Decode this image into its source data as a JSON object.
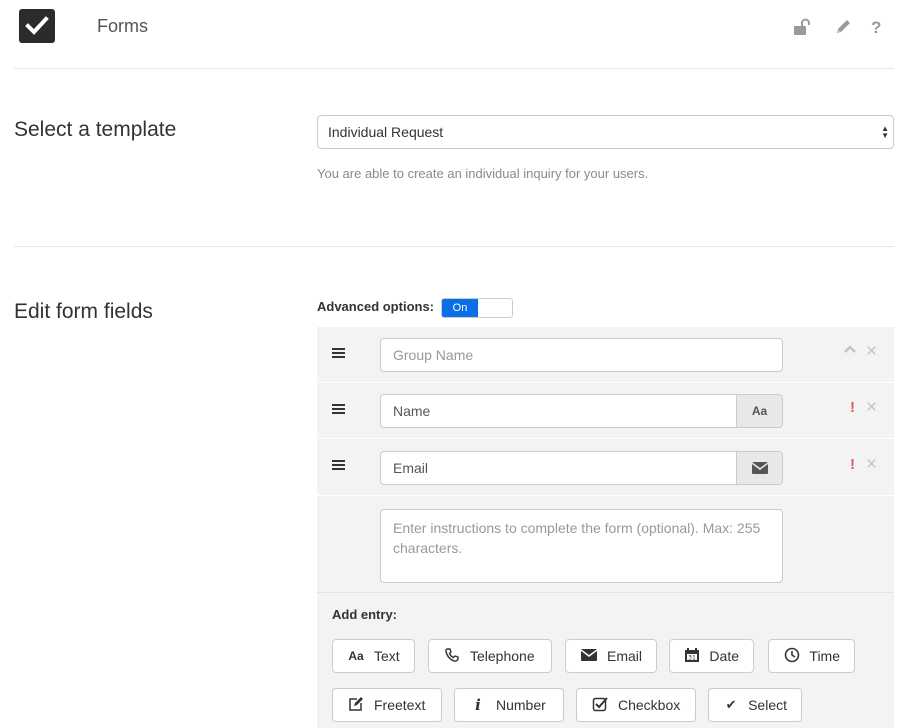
{
  "header": {
    "title": "Forms",
    "logo_icon": "checkbox-icon",
    "actions": [
      {
        "name": "unlock-icon"
      },
      {
        "name": "edit-icon"
      },
      {
        "name": "help-icon",
        "glyph": "?"
      }
    ]
  },
  "template": {
    "section_title": "Select a template",
    "selected": "Individual Request",
    "description": "You are able to create an individual inquiry for your users."
  },
  "fields": {
    "section_title": "Edit form fields",
    "advanced_label": "Advanced options:",
    "advanced_toggle": "On",
    "rows": [
      {
        "placeholder": "Group Name",
        "value": ""
      },
      {
        "value": "Name",
        "addon": "Aa",
        "required_mark": "!"
      },
      {
        "value": "Email",
        "addon_icon": "envelope-icon",
        "required_mark": "!"
      }
    ],
    "instructions_placeholder": "Enter instructions to complete the form (optional). Max: 255 characters.",
    "close_glyph": "×",
    "up_glyph": "^"
  },
  "add_entry": {
    "label": "Add entry:",
    "buttons": [
      {
        "label": "Text",
        "icon": "text-format-icon",
        "glyph": "Aa"
      },
      {
        "label": "Telephone",
        "icon": "phone-icon"
      },
      {
        "label": "Email",
        "icon": "envelope-icon"
      },
      {
        "label": "Date",
        "icon": "calendar-icon",
        "glyph": "31"
      },
      {
        "label": "Time",
        "icon": "clock-icon"
      },
      {
        "label": "Freetext",
        "icon": "edit-square-icon"
      },
      {
        "label": "Number",
        "icon": "info-icon",
        "glyph": "i"
      },
      {
        "label": "Checkbox",
        "icon": "checkbox-icon"
      },
      {
        "label": "Select",
        "icon": "checkmark-icon",
        "glyph": "✔"
      }
    ]
  },
  "colors": {
    "accent": "#0a6fe6",
    "required": "#e05a5a",
    "panel": "#f3f3f3"
  }
}
